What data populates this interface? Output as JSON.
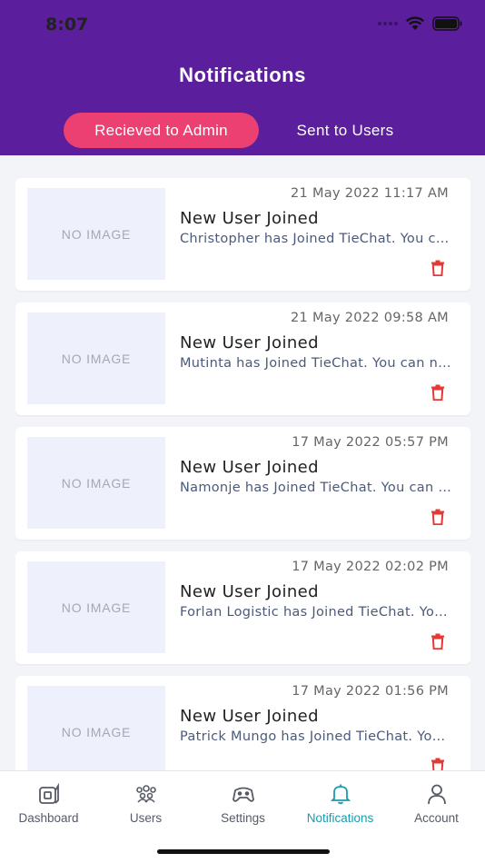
{
  "status_bar": {
    "time": "8:07"
  },
  "header": {
    "title": "Notifications",
    "tabs": [
      {
        "label": "Recieved to Admin",
        "active": true
      },
      {
        "label": "Sent to Users",
        "active": false
      }
    ]
  },
  "notifications": [
    {
      "image_placeholder": "NO IMAGE",
      "date": "21 May 2022  11:17 AM",
      "title": "New User Joined",
      "body": "Christopher has Joined TieChat. You can now chat."
    },
    {
      "image_placeholder": "NO IMAGE",
      "date": "21 May 2022  09:58 AM",
      "title": "New User Joined",
      "body": "Mutinta has Joined TieChat. You can now chat."
    },
    {
      "image_placeholder": "NO IMAGE",
      "date": "17 May 2022  05:57 PM",
      "title": "New User Joined",
      "body": "Namonje has Joined TieChat. You can now chat."
    },
    {
      "image_placeholder": "NO IMAGE",
      "date": "17 May 2022  02:02 PM",
      "title": "New User Joined",
      "body": "Forlan Logistic has Joined TieChat. You can now chat."
    },
    {
      "image_placeholder": "NO IMAGE",
      "date": "17 May 2022  01:56 PM",
      "title": "New User Joined",
      "body": "Patrick Mungo has Joined TieChat. You can now chat."
    }
  ],
  "tabbar": {
    "items": [
      {
        "label": "Dashboard",
        "icon": "dashboard-icon"
      },
      {
        "label": "Users",
        "icon": "users-icon"
      },
      {
        "label": "Settings",
        "icon": "gamepad-icon"
      },
      {
        "label": "Notifications",
        "icon": "bell-icon",
        "active": true
      },
      {
        "label": "Account",
        "icon": "person-icon"
      }
    ]
  },
  "colors": {
    "header": "#5b1e9c",
    "active_tab": "#ec3f72",
    "active_nav": "#1a9bb0",
    "delete": "#e53935"
  }
}
